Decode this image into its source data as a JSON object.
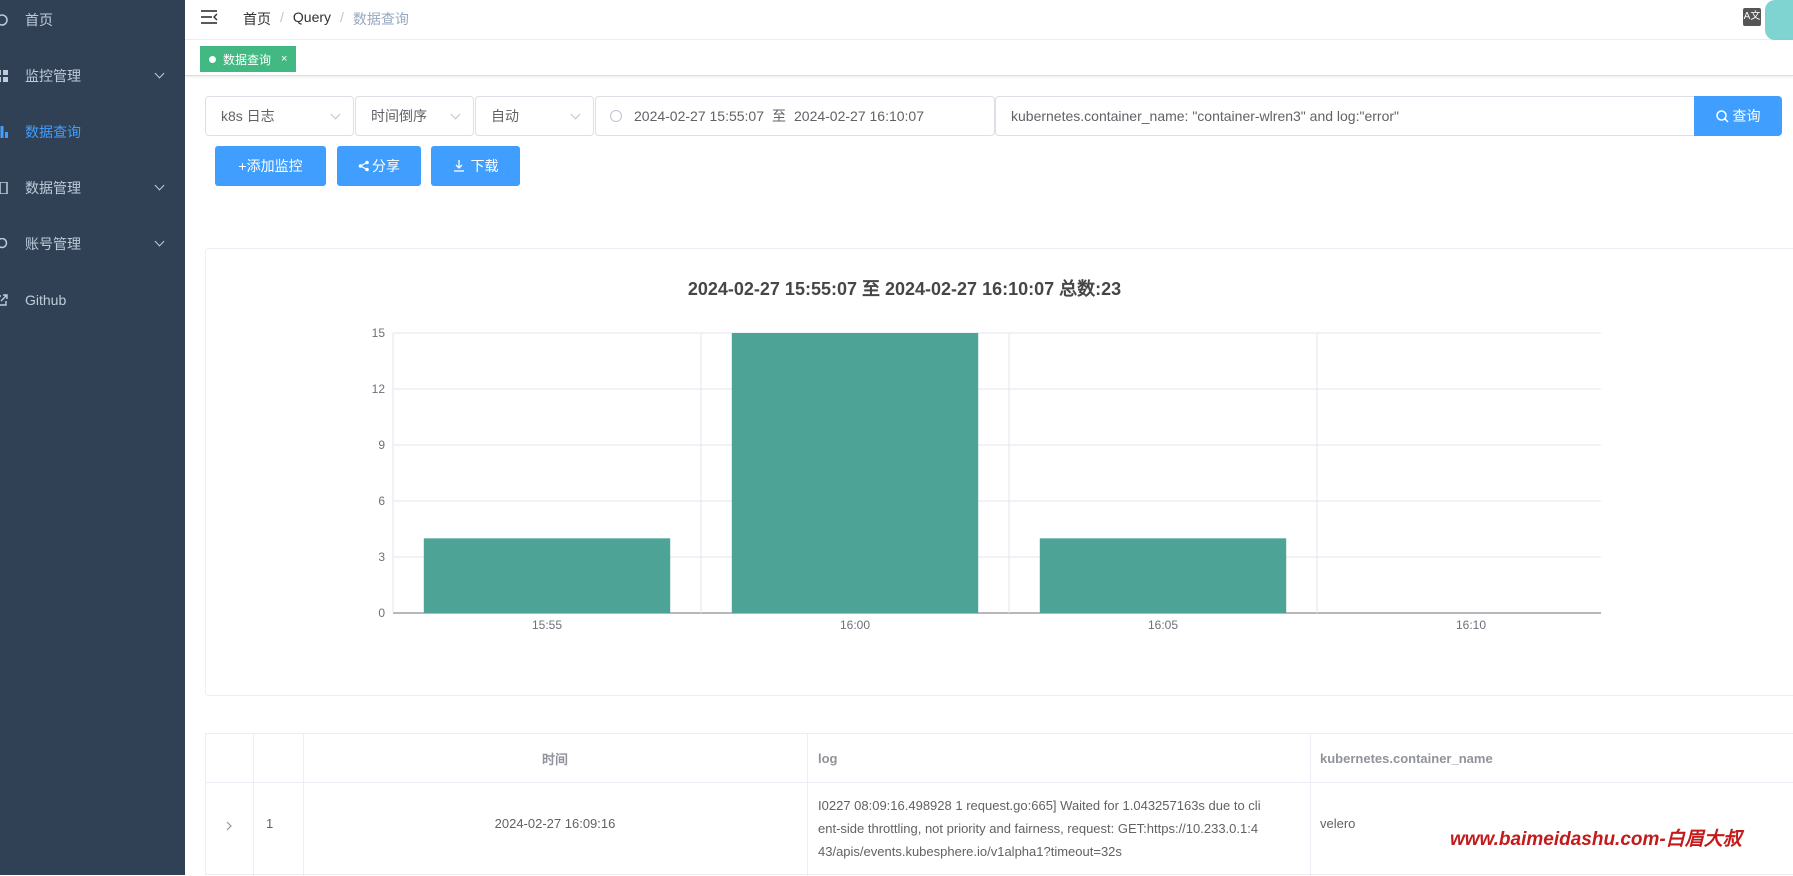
{
  "sidebar": {
    "items": [
      {
        "label": "首页",
        "icon": "dashboard-icon",
        "expandable": false,
        "active": false
      },
      {
        "label": "监控管理",
        "icon": "monitor-icon",
        "expandable": true,
        "active": false
      },
      {
        "label": "数据查询",
        "icon": "chart-icon",
        "expandable": false,
        "active": true
      },
      {
        "label": "数据管理",
        "icon": "book-icon",
        "expandable": true,
        "active": false
      },
      {
        "label": "账号管理",
        "icon": "account-icon",
        "expandable": true,
        "active": false
      },
      {
        "label": "Github",
        "icon": "external-link-icon",
        "expandable": false,
        "active": false
      }
    ]
  },
  "header": {
    "breadcrumb": [
      "首页",
      "Query",
      "数据查询"
    ],
    "lang_icon": "A文"
  },
  "tags": [
    {
      "label": "数据查询",
      "close": "×"
    }
  ],
  "toolbar": {
    "source_select": "k8s 日志",
    "order_select": "时间倒序",
    "interval_select": "自动",
    "date_start": "2024-02-27 15:55:07",
    "date_sep": "至",
    "date_end": "2024-02-27 16:10:07",
    "query": "kubernetes.container_name: \"container-wlren3\" and log:\"error\"",
    "query_button": "查询",
    "add_monitor_button": "+添加监控",
    "share_button": "分享",
    "download_button": "下载"
  },
  "chart_data": {
    "type": "bar",
    "title": "2024-02-27 15:55:07 至 2024-02-27 16:10:07  总数:23",
    "categories": [
      "15:55",
      "16:00",
      "16:05",
      "16:10"
    ],
    "values": [
      4,
      15,
      4,
      0
    ],
    "ylim": [
      0,
      15
    ],
    "yticks": [
      0,
      3,
      6,
      9,
      12,
      15
    ],
    "grid": true,
    "color": "#4ea397"
  },
  "table": {
    "columns": [
      "",
      "",
      "时间",
      "log",
      "kubernetes.container_name"
    ],
    "rows": [
      {
        "index": "1",
        "time": "2024-02-27 16:09:16",
        "log_lines": [
          "I0227 08:09:16.498928 1 request.go:665] Waited for 1.043257163s due to cli",
          "ent-side throttling, not priority and fairness, request: GET:https://10.233.0.1:4",
          "43/apis/events.kubesphere.io/v1alpha1?timeout=32s"
        ],
        "container": "velero"
      }
    ]
  },
  "watermark": "www.baimeidashu.com-白眉大叔"
}
